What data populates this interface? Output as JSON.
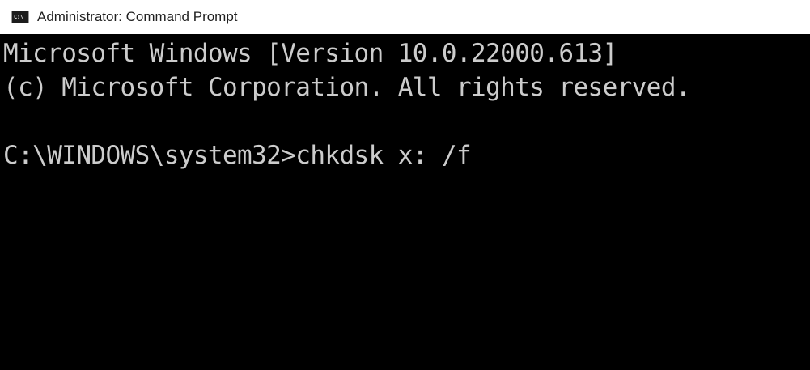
{
  "window": {
    "title": "Administrator: Command Prompt",
    "icon_name": "command-prompt-icon",
    "icon_text": "C:\\"
  },
  "console": {
    "lines": [
      "Microsoft Windows [Version 10.0.22000.613]",
      "(c) Microsoft Corporation. All rights reserved.",
      "",
      "C:\\WINDOWS\\system32>chkdsk x: /f"
    ]
  },
  "colors": {
    "console_background": "#000000",
    "console_text": "#cccccc",
    "titlebar_background": "#ffffff"
  }
}
